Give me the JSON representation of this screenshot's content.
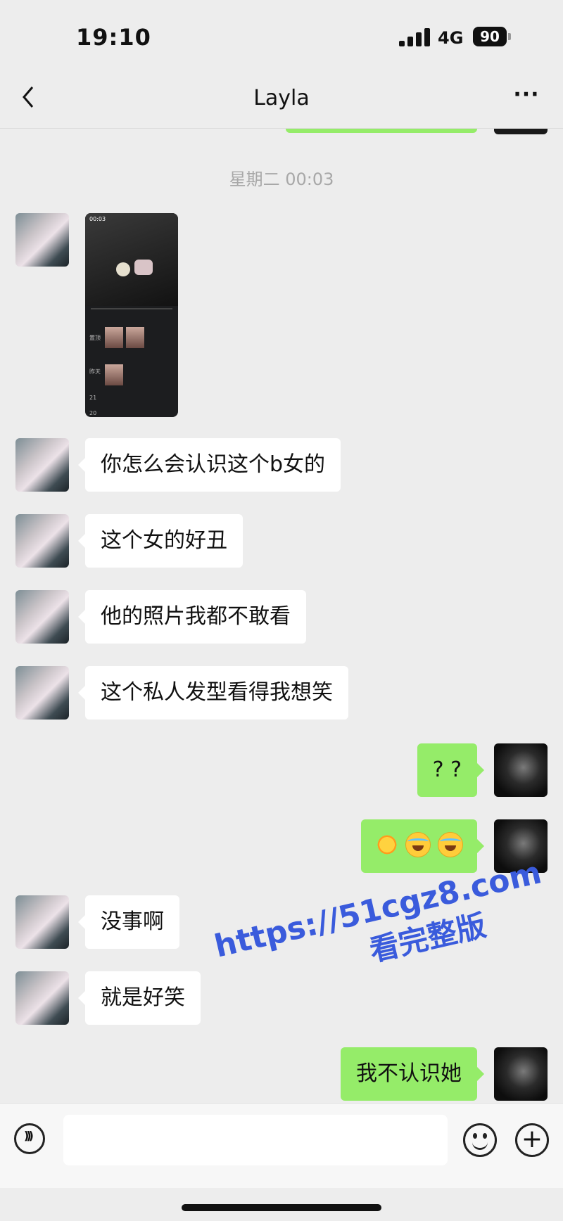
{
  "status_bar": {
    "time": "19:10",
    "network": "4G",
    "battery": "90"
  },
  "nav": {
    "title": "Layla",
    "more_label": "···"
  },
  "chat": {
    "timestamp": "星期二 00:03",
    "messages": [
      {
        "side": "in",
        "type": "image",
        "text": ""
      },
      {
        "side": "in",
        "type": "text",
        "text": "你怎么会认识这个b女的"
      },
      {
        "side": "in",
        "type": "text",
        "text": "这个女的好丑"
      },
      {
        "side": "in",
        "type": "text",
        "text": "他的照片我都不敢看"
      },
      {
        "side": "in",
        "type": "text",
        "text": "这个私人发型看得我想笑"
      },
      {
        "side": "out",
        "type": "text",
        "text": "? ?"
      },
      {
        "side": "out",
        "type": "emoji",
        "emojis": [
          "sun-icon",
          "laughing-crying-icon",
          "laughing-crying-icon"
        ]
      },
      {
        "side": "in",
        "type": "text",
        "text": "没事啊"
      },
      {
        "side": "in",
        "type": "text",
        "text": "就是好笑"
      },
      {
        "side": "out",
        "type": "text",
        "text": "我不认识她"
      }
    ]
  },
  "screenshot_thumb": {
    "time": "00:03",
    "label_1": "置顶",
    "label_2": "昨天",
    "label_3": "21",
    "label_4": "20"
  },
  "watermark": {
    "line1": "https://51cgz8.com",
    "line2": "看完整版"
  },
  "input_bar": {
    "placeholder": "",
    "plus_label": "+"
  },
  "colors": {
    "background": "#ededed",
    "outgoing_bubble": "#95ec69",
    "incoming_bubble": "#ffffff",
    "watermark": "#3a5bdc"
  }
}
